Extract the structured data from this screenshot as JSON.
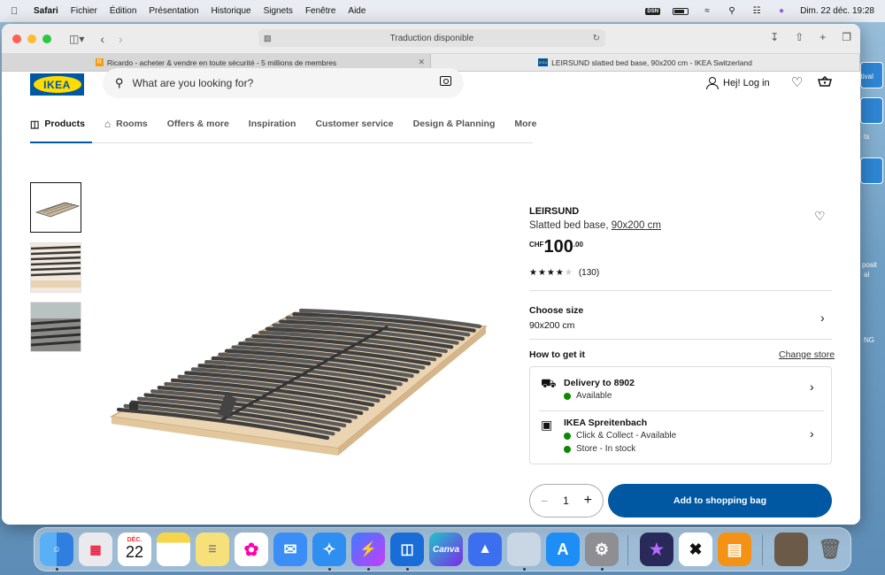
{
  "menubar": {
    "app": "Safari",
    "menus": [
      "Fichier",
      "Édition",
      "Présentation",
      "Historique",
      "Signets",
      "Fenêtre",
      "Aide"
    ],
    "badge": "DSN",
    "datetime": "Dim. 22 déc.  19:28"
  },
  "browser": {
    "address_text": "Traduction disponible",
    "tabs": [
      {
        "favicon": "R",
        "title": "Ricardo - acheter & vendre en toute sécurité - 5 millions de membres"
      },
      {
        "favicon": "IKEA",
        "title": "LEIRSUND slatted bed base, 90x200 cm - IKEA Switzerland"
      }
    ]
  },
  "header": {
    "logo_text": "IKEA",
    "search_placeholder": "What are you looking for?",
    "login": "Hej! Log in"
  },
  "nav": {
    "items": [
      "Products",
      "Rooms",
      "Offers & more",
      "Inspiration",
      "Customer service",
      "Design & Planning",
      "More"
    ]
  },
  "product": {
    "name": "LEIRSUND",
    "desc_prefix": "Slatted bed base, ",
    "desc_size": "90x200 cm",
    "currency": "CHF",
    "price_int": "100",
    "price_dec": ".00",
    "rating_count": "(130)",
    "rating_value": 4,
    "choose_size_label": "Choose size",
    "size_value": "90x200 cm",
    "how_to_get": "How to get it",
    "change_store": "Change store",
    "delivery_title": "Delivery to 8902",
    "delivery_status": "Available",
    "store_title": "IKEA Spreitenbach",
    "store_line1": "Click & Collect - Available",
    "store_line2": "Store - In stock",
    "quantity": "1",
    "add_button": "Add to shopping bag"
  },
  "desktop": {
    "labels": [
      "rtival",
      "ts",
      "posit",
      "al",
      "NG"
    ]
  },
  "dock": {
    "calendar_month": "DÉC.",
    "calendar_day": "22",
    "canva_label": "Canva"
  },
  "colors": {
    "ikea_blue": "#0058a3",
    "ikea_yellow": "#ffdb00",
    "available_green": "#0a8a00"
  }
}
